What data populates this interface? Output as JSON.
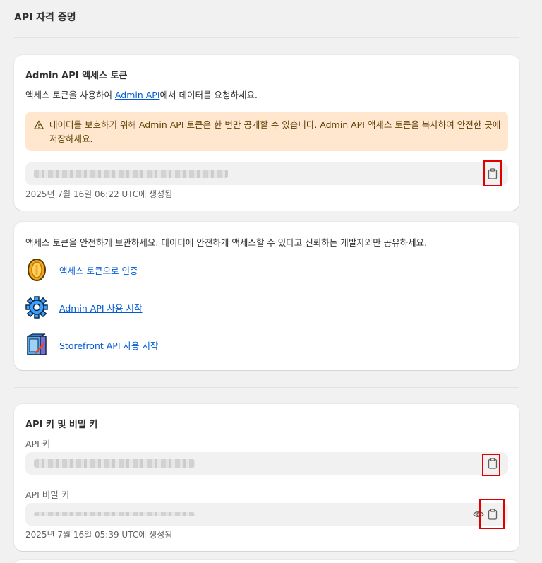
{
  "page": {
    "title": "API 자격 증명"
  },
  "admin_token_card": {
    "title": "Admin API 액세스 토큰",
    "desc_prefix": "액세스 토큰을 사용하여 ",
    "desc_link": "Admin API",
    "desc_suffix": "에서 데이터를 요청하세요.",
    "banner_text": "데이터를 보호하기 위해 Admin API 토큰은 한 번만 공개할 수 있습니다. Admin API 액세스 토큰을 복사하여 안전한 곳에 저장하세요.",
    "created": "2025년 7월 16일 06:22 UTC에 생성됨"
  },
  "security_card": {
    "text": "액세스 토큰을 안전하게 보관하세요. 데이터에 안전하게 액세스할 수 있다고 신뢰하는 개발자와만 공유하세요.",
    "links": [
      {
        "label": "액세스 토큰으로 인증",
        "icon": "coin-icon"
      },
      {
        "label": "Admin API 사용 시작",
        "icon": "gear-icon"
      },
      {
        "label": "Storefront API 사용 시작",
        "icon": "storefront-icon"
      }
    ]
  },
  "api_keys_card": {
    "title": "API 키 및 비밀 키",
    "api_key_label": "API 키",
    "secret_key_label": "API 비밀 키",
    "created": "2025년 7월 16일 05:39 UTC에 생성됨"
  },
  "colors": {
    "link": "#005bd3",
    "banner_bg": "#ffe6cf",
    "highlight": "#e00000"
  }
}
